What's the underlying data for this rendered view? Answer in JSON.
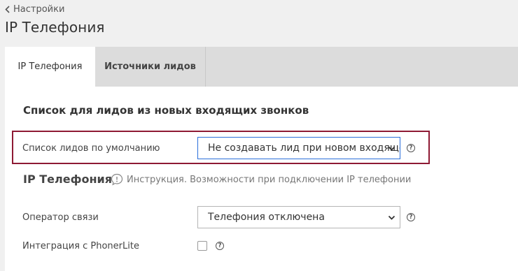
{
  "header": {
    "back_label": "Настройки",
    "title": "IP Телефония"
  },
  "tabs": [
    {
      "label": "IP Телефония",
      "active": true
    },
    {
      "label": "Источники лидов",
      "active": false
    }
  ],
  "leads_section": {
    "heading": "Список для лидов из новых входящих звонков",
    "default_list_label": "Список лидов по умолчанию",
    "default_list_value": "Не создавать лид при новом входящем"
  },
  "ip_section": {
    "heading": "IP Телефония",
    "instruction_text": "Инструкция. Возможности при подключении IP телефонии",
    "operator_label": "Оператор связи",
    "operator_value": "Телефония отключена",
    "phonerlite_label": "Интеграция с PhonerLite",
    "phonerlite_checked": false
  },
  "help_glyph": "?",
  "colors": {
    "highlight_border": "#8e1a34",
    "focus_border": "#2a6fdb",
    "tab_bar": "#dcdcdc",
    "page_bg": "#f0f0f0"
  }
}
